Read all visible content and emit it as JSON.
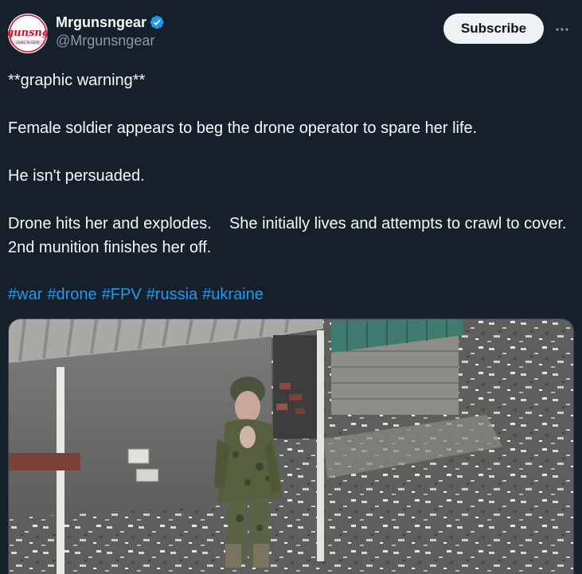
{
  "author": {
    "display_name": "Mrgunsngear",
    "handle": "@Mrgunsngear",
    "verified": true,
    "avatar_text": "gunsng",
    "avatar_subtext": "GUNS 'N GEAR"
  },
  "actions": {
    "subscribe_label": "Subscribe",
    "more_icon": "more-horizontal-icon"
  },
  "tweet": {
    "paragraphs": [
      "**graphic warning**",
      "Female soldier appears to beg the drone operator to spare her life.",
      "He isn't persuaded.",
      "Drone hits her and explodes.    She initially lives and attempts to crawl to cover.   2nd munition finishes her off."
    ],
    "hashtags": [
      "#war",
      "#drone",
      "#FPV",
      "#russia",
      "#ukraine"
    ]
  },
  "colors": {
    "background": "#15202b",
    "text": "#f7f9f9",
    "secondary_text": "#8b98a5",
    "link": "#1d9bf0",
    "verified_badge": "#1d9bf0",
    "subscribe_bg": "#eff3f4"
  }
}
